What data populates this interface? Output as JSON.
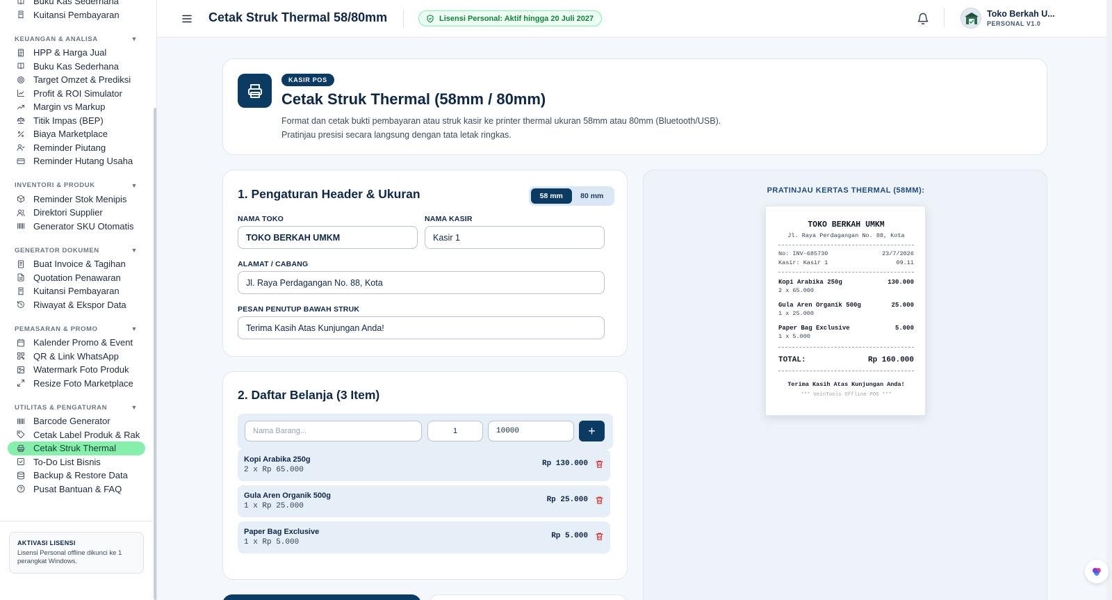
{
  "sidebar": {
    "top_items": [
      {
        "label": "Buku Kas Sederhana",
        "icon": "book-icon"
      },
      {
        "label": "Kuitansi Pembayaran",
        "icon": "receipt-icon"
      }
    ],
    "sections": [
      {
        "title": "KEUANGAN & ANALISA",
        "items": [
          {
            "label": "HPP & Harga Jual",
            "icon": "calculator-icon"
          },
          {
            "label": "Buku Kas Sederhana",
            "icon": "book-icon"
          },
          {
            "label": "Target Omzet & Prediksi",
            "icon": "target-icon"
          },
          {
            "label": "Profit & ROI Simulator",
            "icon": "line-chart-icon"
          },
          {
            "label": "Margin vs Markup",
            "icon": "trending-up-icon"
          },
          {
            "label": "Titik Impas (BEP)",
            "icon": "scale-icon"
          },
          {
            "label": "Biaya Marketplace",
            "icon": "percent-icon"
          },
          {
            "label": "Reminder Piutang",
            "icon": "user-clock-icon"
          },
          {
            "label": "Reminder Hutang Usaha",
            "icon": "credit-card-icon"
          }
        ]
      },
      {
        "title": "INVENTORI & PRODUK",
        "items": [
          {
            "label": "Reminder Stok Menipis",
            "icon": "package-icon"
          },
          {
            "label": "Direktori Supplier",
            "icon": "users-icon"
          },
          {
            "label": "Generator SKU Otomatis",
            "icon": "barcode-icon"
          }
        ]
      },
      {
        "title": "GENERATOR DOKUMEN",
        "items": [
          {
            "label": "Buat Invoice & Tagihan",
            "icon": "invoice-icon"
          },
          {
            "label": "Quotation Penawaran",
            "icon": "document-icon"
          },
          {
            "label": "Kuitansi Pembayaran",
            "icon": "receipt-icon"
          },
          {
            "label": "Riwayat & Ekspor Data",
            "icon": "history-icon"
          }
        ]
      },
      {
        "title": "PEMASARAN & PROMO",
        "items": [
          {
            "label": "Kalender Promo & Event",
            "icon": "calendar-icon"
          },
          {
            "label": "QR & Link WhatsApp",
            "icon": "qr-icon"
          },
          {
            "label": "Watermark Foto Produk",
            "icon": "image-icon"
          },
          {
            "label": "Resize Foto Marketplace",
            "icon": "resize-icon"
          }
        ]
      },
      {
        "title": "UTILITAS & PENGATURAN",
        "items": [
          {
            "label": "Barcode Generator",
            "icon": "barcode-icon"
          },
          {
            "label": "Cetak Label Produk & Rak",
            "icon": "tag-icon"
          },
          {
            "label": "Cetak Struk Thermal",
            "icon": "printer-icon",
            "active": true
          },
          {
            "label": "To-Do List Bisnis",
            "icon": "checkbox-icon"
          },
          {
            "label": "Backup & Restore Data",
            "icon": "database-icon"
          },
          {
            "label": "Pusat Bantuan & FAQ",
            "icon": "help-icon"
          }
        ]
      }
    ],
    "license": {
      "title": "AKTIVASI LISENSI",
      "desc": "Lisensi Personal offline dikunci ke 1 perangkat Windows."
    }
  },
  "header": {
    "title": "Cetak Struk Thermal 58/80mm",
    "license_badge": "Lisensi Personal: Aktif hingga 20 Juli 2027",
    "user_name": "Toko Berkah U...",
    "user_version": "PERSONAL V1.0"
  },
  "hero": {
    "badge": "KASIR POS",
    "title": "Cetak Struk Thermal (58mm / 80mm)",
    "desc_line1": "Format dan cetak bukti pembayaran atau struk kasir ke printer thermal ukuran 58mm atau 80mm (Bluetooth/USB).",
    "desc_line2": "Pratinjau presisi secara langsung dengan tata letak ringkas."
  },
  "form": {
    "title": "1. Pengaturan Header & Ukuran",
    "size_options": [
      "58 mm",
      "80 mm"
    ],
    "selected_size": "58 mm",
    "store_label": "NAMA TOKO",
    "store_value": "TOKO BERKAH UMKM",
    "cashier_label": "NAMA KASIR",
    "cashier_value": "Kasir 1",
    "address_label": "ALAMAT / CABANG",
    "address_value": "Jl. Raya Perdagangan No. 88, Kota",
    "footer_label": "PESAN PENUTUP BAWAH STRUK",
    "footer_value": "Terima Kasih Atas Kunjungan Anda!"
  },
  "list": {
    "title": "2. Daftar Belanja (3 Item)",
    "name_placeholder": "Nama Barang...",
    "qty_value": "1",
    "price_value": "10000",
    "add_label": "+",
    "items": [
      {
        "name": "Kopi Arabika 250g",
        "qty": "2 x Rp 65.000",
        "total": "Rp 130.000"
      },
      {
        "name": "Gula Aren Organik 500g",
        "qty": "1 x Rp 25.000",
        "total": "Rp 25.000"
      },
      {
        "name": "Paper Bag Exclusive",
        "qty": "1 x Rp 5.000",
        "total": "Rp 5.000"
      }
    ]
  },
  "preview": {
    "title": "PRATINJAU KERTAS THERMAL (58MM):",
    "store": "TOKO BERKAH UMKM",
    "address": "Jl. Raya Perdagangan No. 88, Kota",
    "invoice_no": "No: INV-685730",
    "date": "23/7/2026",
    "cashier": "Kasir: Kasir 1",
    "time": "09.11",
    "items": [
      {
        "name": "Kopi Arabika 250g",
        "total": "130.000",
        "qty": "2 x 65.000"
      },
      {
        "name": "Gula Aren Organik 500g",
        "total": "25.000",
        "qty": "1 x 25.000"
      },
      {
        "name": "Paper Bag Exclusive",
        "total": "5.000",
        "qty": "1 x 5.000"
      }
    ],
    "total_label": "TOTAL:",
    "total_value": "Rp 160.000",
    "footer": "Terima Kasih Atas Kunjungan Anda!",
    "footer2": "*** VeinTools Offline POS ***"
  },
  "colors": {
    "primary": "#0b3a62",
    "active": "#86efac",
    "license_green": "#15803d",
    "danger": "#dc2626"
  }
}
